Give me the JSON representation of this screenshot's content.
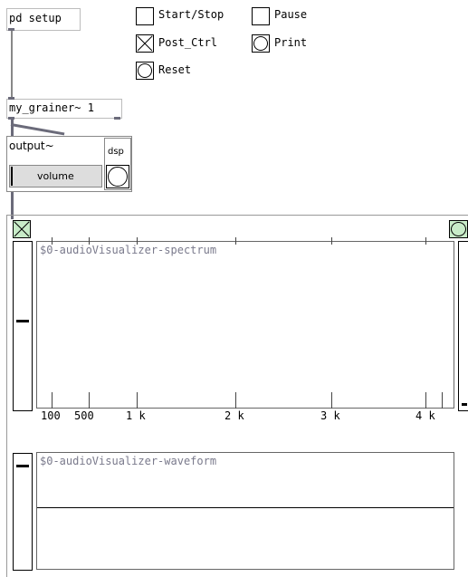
{
  "objects": {
    "pd_setup": "pd setup",
    "grainer": "my_grainer~ 1"
  },
  "controls": {
    "start_stop": "Start/Stop",
    "pause": "Pause",
    "post_ctrl": "Post_Ctrl",
    "print": "Print",
    "reset": "Reset"
  },
  "output": {
    "title": "output~",
    "dsp": "dsp",
    "volume": "volume"
  },
  "spectrum": {
    "name": "$0-audioVisualizer-spectrum",
    "tick_labels": [
      "100",
      "500",
      "1 k",
      "2 k",
      "3 k",
      "4 k"
    ]
  },
  "waveform": {
    "name": "$0-audioVisualizer-waveform"
  }
}
